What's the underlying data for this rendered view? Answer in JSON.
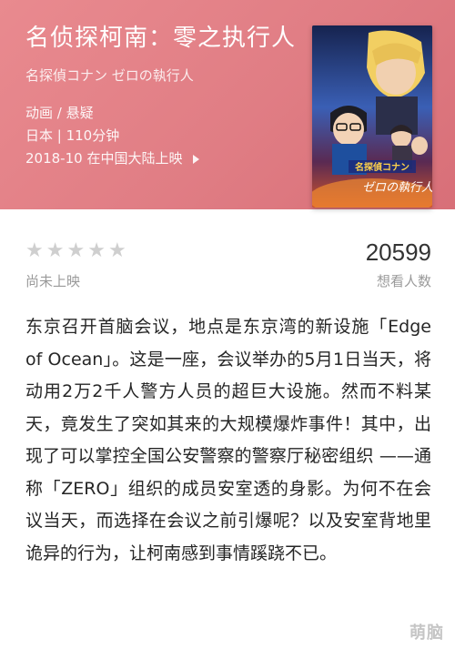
{
  "movie": {
    "title": "名侦探柯南：零之执行人",
    "original_title": "名探偵コナン ゼロの執行人",
    "genres": "动画 / 悬疑",
    "country_duration": "日本 | 110分钟",
    "release": "2018-10 在中国大陆上映"
  },
  "poster": {
    "logo_text": "名探偵コナン",
    "subtitle_text": "ゼロの執行人"
  },
  "rating": {
    "stars_total": 5,
    "stars_filled": 0,
    "status": "尚未上映",
    "want_count": "20599",
    "want_label": "想看人数"
  },
  "synopsis": "东京召开首脑会议，地点是东京湾的新设施「Edge of Ocean」。这是一座，会议举办的5月1日当天，将动用2万2千人警方人员的超巨大设施。然而不料某天，竟发生了突如其来的大规模爆炸事件！其中，出现了可以掌控全国公安警察的警察厅秘密组织 ——通称「ZERO」组织的成员安室透的身影。为何不在会议当天，而选择在会议之前引爆呢？以及安室背地里诡异的行为，让柯南感到事情蹊跷不已。",
  "watermark": "萌脑",
  "colors": {
    "hero_bg": "#e07d84",
    "star_empty": "#cfcfcf",
    "muted_text": "#9a9a9a"
  }
}
